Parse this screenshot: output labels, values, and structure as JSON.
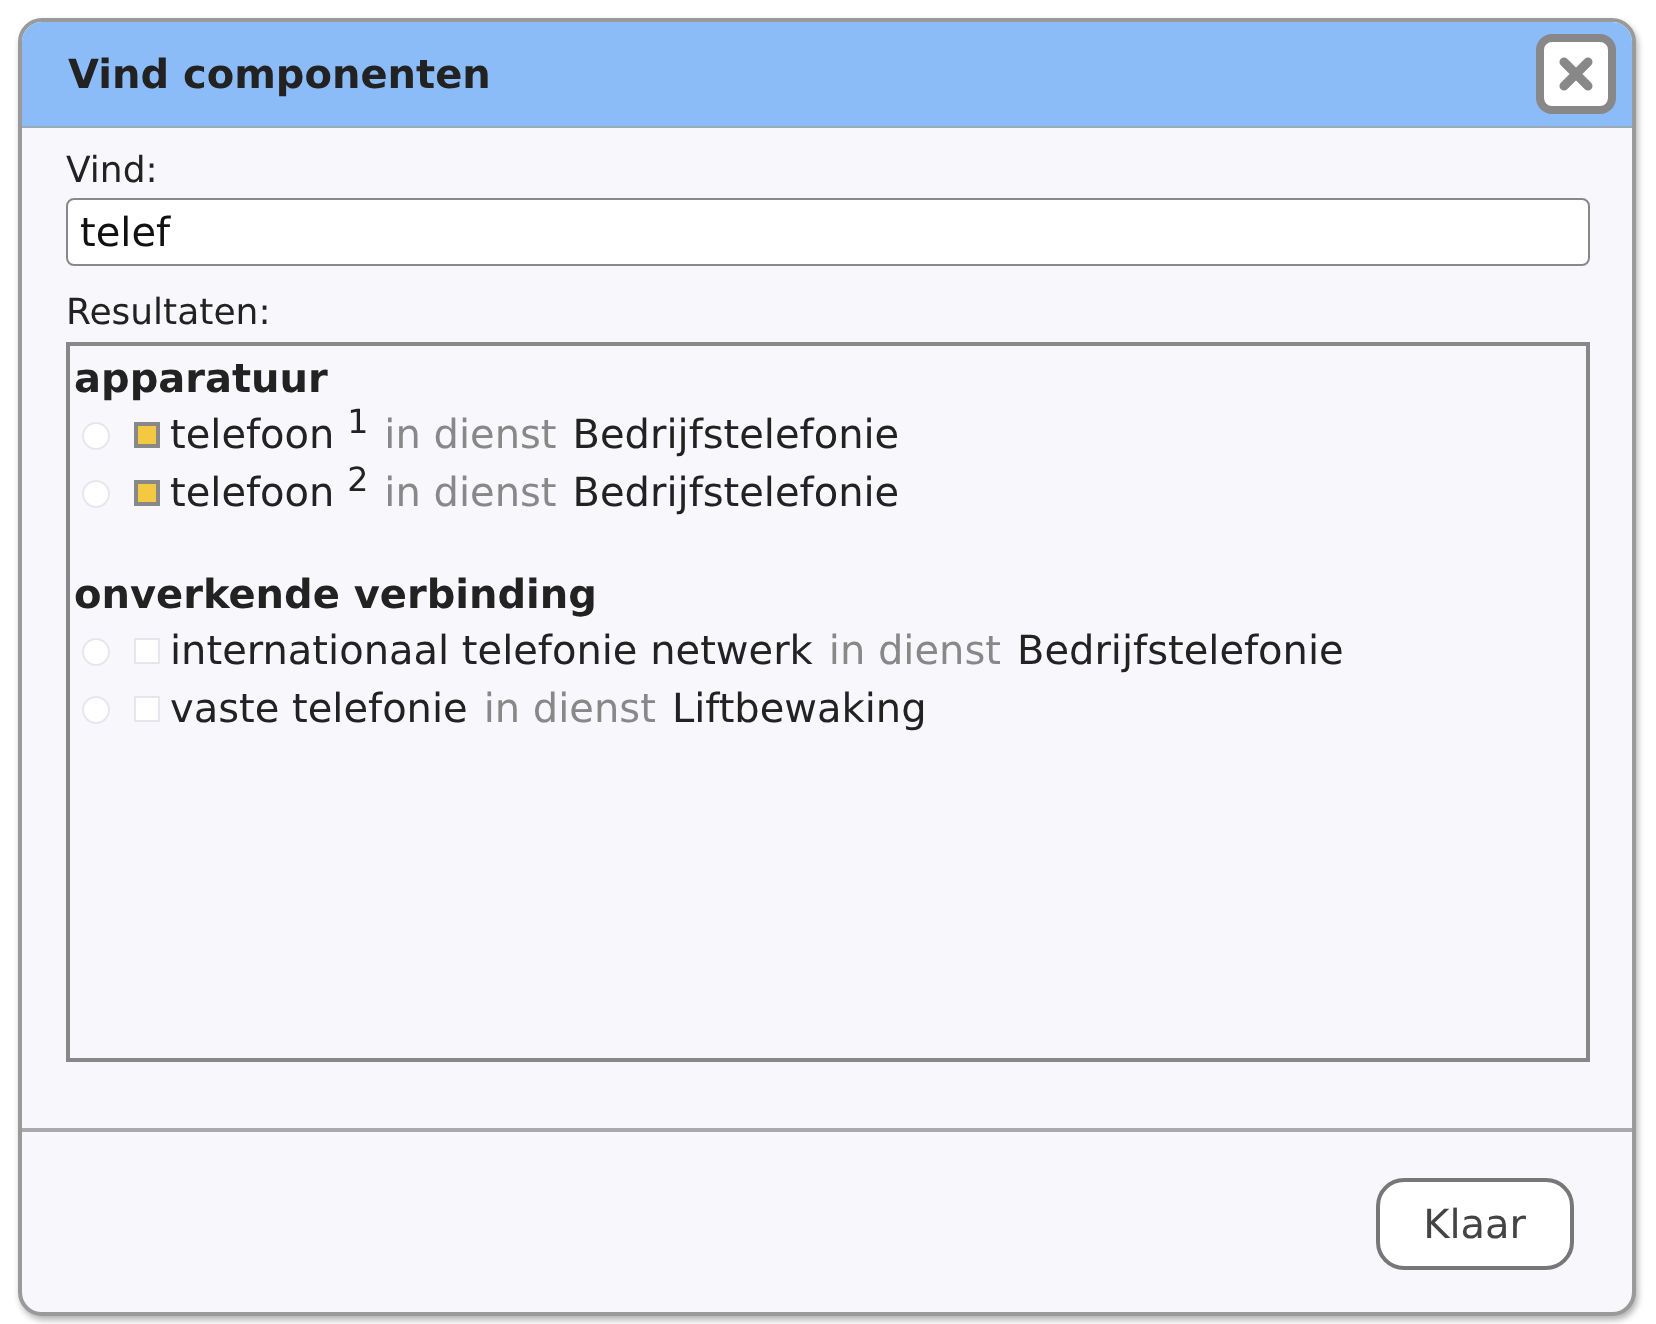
{
  "dialog": {
    "title": "Vind componenten"
  },
  "search": {
    "label": "Vind:",
    "value": "telef"
  },
  "results": {
    "label": "Resultaten:",
    "groups": [
      {
        "title": "apparatuur",
        "items": [
          {
            "selected": false,
            "name": "telefoon $^{1}$",
            "status": "in dienst",
            "service": "Bedrijfstelefonie",
            "color": "#f5c842"
          },
          {
            "selected": false,
            "name": "telefoon $^{2}$",
            "status": "in dienst",
            "service": "Bedrijfstelefonie",
            "color": "#f5c842"
          }
        ]
      },
      {
        "title": "onverkende verbinding",
        "items": [
          {
            "selected": false,
            "name": "internationaal telefonie netwerk",
            "status": "in dienst",
            "service": "Bedrijfstelefonie"
          },
          {
            "selected": false,
            "name": "vaste telefonie",
            "status": "in dienst",
            "service": "Liftbewaking"
          }
        ]
      }
    ]
  },
  "buttons": [
    "Klaar"
  ]
}
